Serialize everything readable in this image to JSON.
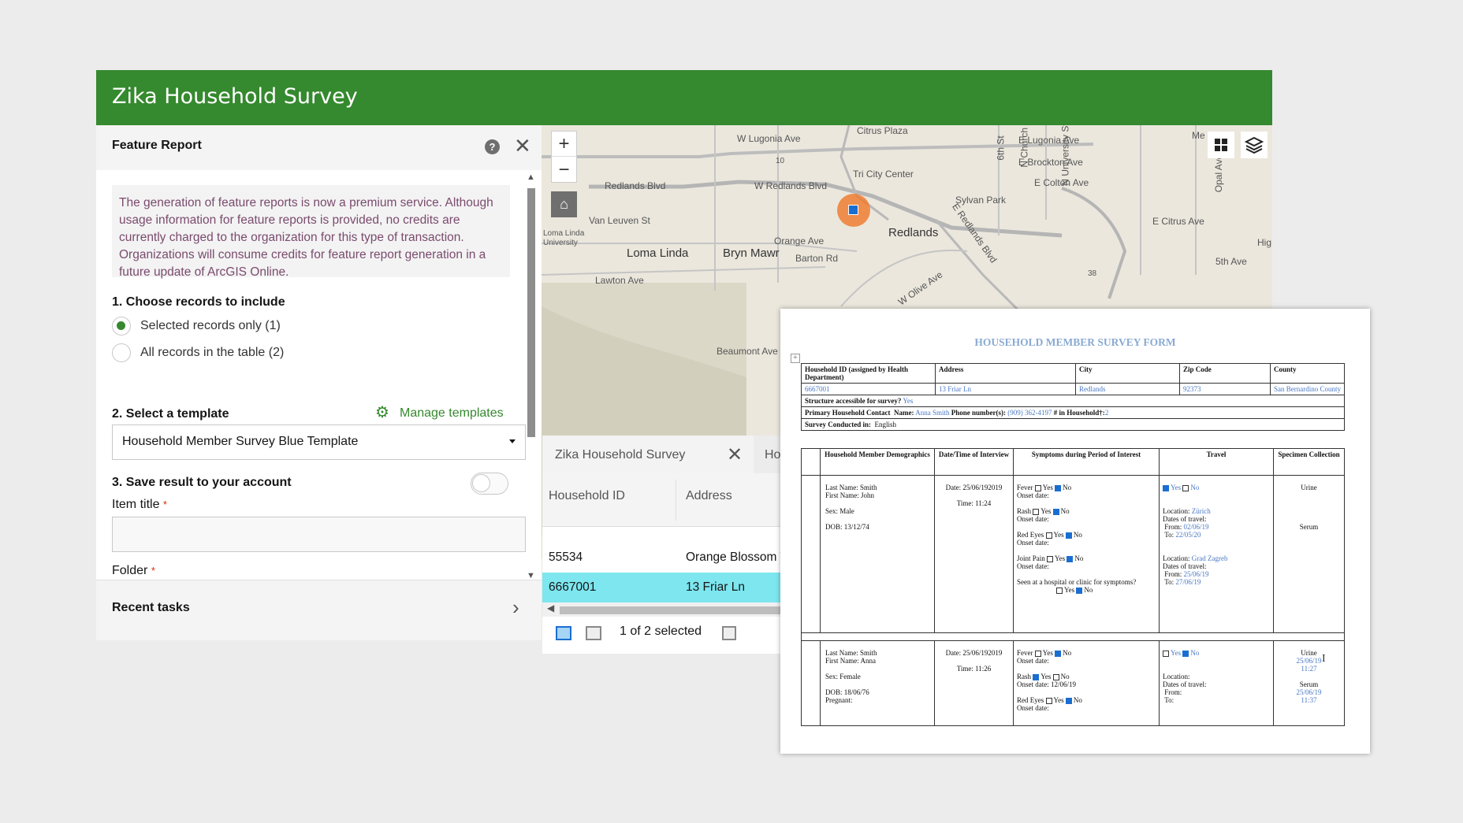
{
  "app": {
    "title": "Zika Household Survey"
  },
  "panel": {
    "title": "Feature Report",
    "notice": "The generation of feature reports is now a premium service. Although usage information for feature reports is provided, no credits are currently charged to the organization for this type of transaction. Organizations will consume credits for feature report generation in a future update of ArcGIS Online.",
    "step1_label": "1. Choose records to include",
    "option_selected": "Selected records only (1)",
    "option_all": "All records in the table (2)",
    "step2_label": "2. Select a template",
    "manage_templates": "Manage templates",
    "template_value": "Household Member Survey Blue Template",
    "step3_label": "3. Save result to your account",
    "item_title_label": "Item title",
    "folder_label": "Folder",
    "required_mark": "*",
    "recent_tasks": "Recent tasks"
  },
  "map": {
    "labels": [
      "W Lugonia Ave",
      "Citrus Plaza",
      "E Lugonia Ave",
      "E Brockton Ave",
      "E Colton Ave",
      "Redlands Blvd",
      "W Redlands Blvd",
      "Tri City Center",
      "Sylvan Park",
      "Redlands",
      "E Citrus Ave",
      "Van Leuven St",
      "Loma Linda University",
      "Orange Ave",
      "Loma Linda",
      "Bryn Mawr",
      "Barton Rd",
      "Lawton Ave",
      "Beaumont Ave",
      "5th Ave",
      "6th St",
      "N Church St",
      "N University St",
      "Opal Ave",
      "E Redlands Blvd",
      "W Olive Ave",
      "10",
      "38",
      "Hig",
      "Me"
    ]
  },
  "table": {
    "tab_label": "Zika Household Survey",
    "tab_next": "Ho",
    "columns": [
      "Household ID",
      "Address"
    ],
    "rows": [
      {
        "id": "55534",
        "address": "Orange Blossom Tr"
      },
      {
        "id": "6667001",
        "address": "13 Friar Ln"
      }
    ],
    "status": "1 of 2 selected"
  },
  "report": {
    "title": "HOUSEHOLD MEMBER SURVEY FORM",
    "header_cols": [
      "Household ID (assigned by Health Department)",
      "Address",
      "City",
      "Zip Code",
      "County"
    ],
    "header_vals": [
      "6667001",
      "13 Friar Ln",
      "Redlands",
      "92373",
      "San Bernardino County"
    ],
    "accessible_label": "Structure accessible for survey?",
    "accessible_val": "Yes",
    "contact_label": "Primary Household Contact",
    "name_label": "Name:",
    "contact_name": "Anna Smith",
    "phone_label": "Phone number(s):",
    "phone": "(909) 362-4197",
    "household_label": "# in Household†:",
    "household_count": "2",
    "conducted_label": "Survey Conducted in:",
    "conducted_val": "English",
    "table_cols": [
      "Household Member Demographics",
      "Date/Time of Interview",
      "Symptoms during Period of Interest",
      "Travel",
      "Specimen Collection"
    ],
    "member1": {
      "last": "Last Name: Smith",
      "first": "First Name: John",
      "sex": "Sex: Male",
      "dob": "DOB: 13/12/74",
      "date": "Date: 25/06/192019",
      "time": "Time: 11:24",
      "s1": "Fever",
      "s2": "Rash",
      "s3": "Red Eyes",
      "s4": "Joint Pain",
      "onset": "Onset date:",
      "hospital": "Seen at a hospital or clinic for symptoms?",
      "yes": "Yes",
      "no": "No",
      "loc1_label": "Location:",
      "loc1": "Zürich",
      "dates_label": "Dates of travel:",
      "from_label": "From:",
      "to_label": "To:",
      "from1": "02/06/19",
      "to1": "22/05/20",
      "loc2": "Grad Zagreb",
      "from2": "25/06/19",
      "to2": "27/06/19",
      "spec1": "Urine",
      "spec2": "Serum"
    },
    "member2": {
      "last": "Last Name: Smith",
      "first": "First Name: Anna",
      "sex": "Sex: Female",
      "dob": "DOB: 18/06/76",
      "pregnant": "Pregnant:",
      "date": "Date: 25/06/192019",
      "time": "Time: 11:26",
      "rash_onset": "Onset date: 12/06/19",
      "spec1": "Urine",
      "spec1_date": "25/06/19",
      "spec1_time": "11:27",
      "spec2": "Serum",
      "spec2_date": "25/06/19",
      "spec2_time": "11:37"
    }
  }
}
